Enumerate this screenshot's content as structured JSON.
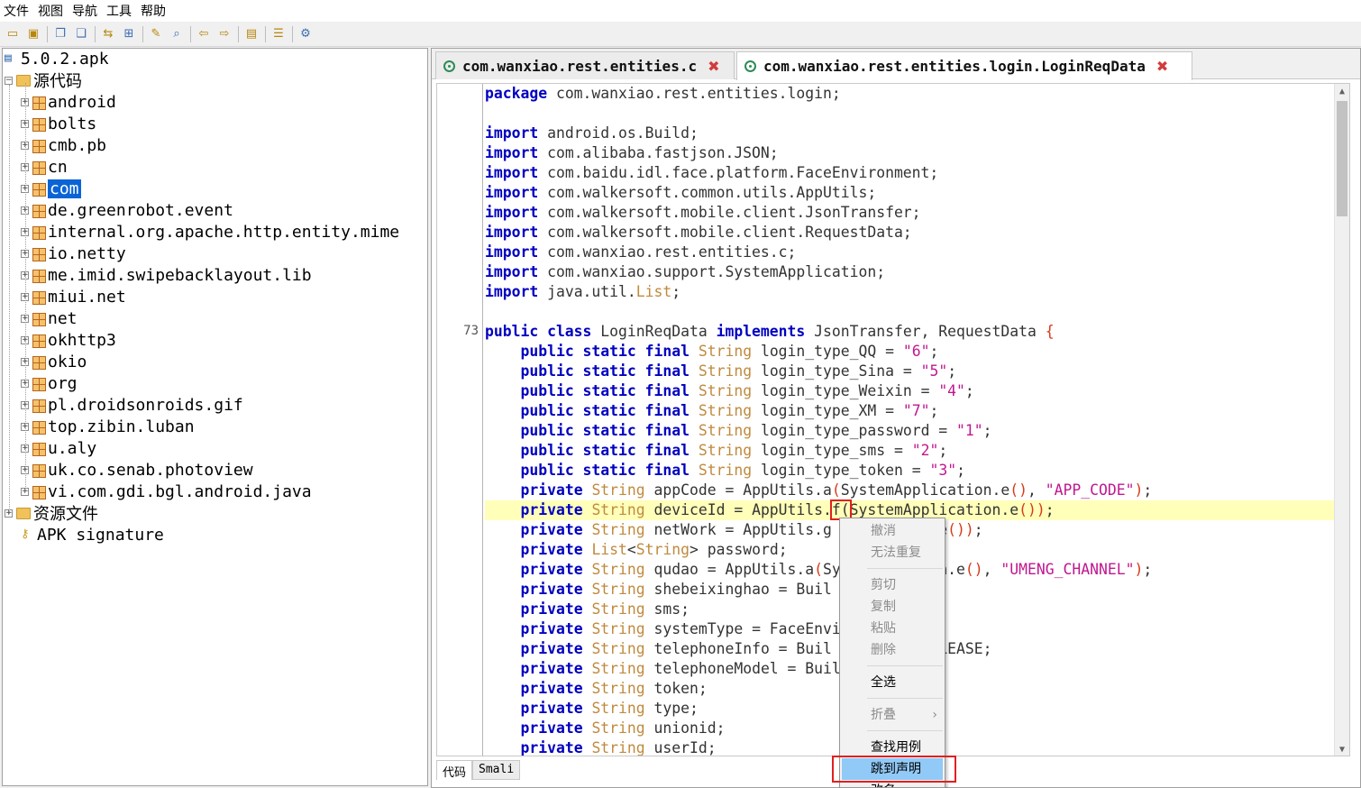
{
  "menu": [
    "文件",
    "视图",
    "导航",
    "工具",
    "帮助"
  ],
  "toolbar_icons": [
    "open-folder-icon",
    "add-folder-icon",
    "copy-icon",
    "paste-icon",
    "sync-icon",
    "grid-icon",
    "wand-icon",
    "search-icon",
    "back-icon",
    "forward-icon",
    "export-icon",
    "log-icon",
    "settings-icon"
  ],
  "tree": {
    "root": "5.0.2.apk",
    "source_folder": "源代码",
    "packages": [
      {
        "label": "android",
        "selected": false
      },
      {
        "label": "bolts",
        "selected": false
      },
      {
        "label": "cmb.pb",
        "selected": false
      },
      {
        "label": "cn",
        "selected": false
      },
      {
        "label": "com",
        "selected": true
      },
      {
        "label": "de.greenrobot.event",
        "selected": false
      },
      {
        "label": "internal.org.apache.http.entity.mime",
        "selected": false
      },
      {
        "label": "io.netty",
        "selected": false
      },
      {
        "label": "me.imid.swipebacklayout.lib",
        "selected": false
      },
      {
        "label": "miui.net",
        "selected": false
      },
      {
        "label": "net",
        "selected": false
      },
      {
        "label": "okhttp3",
        "selected": false
      },
      {
        "label": "okio",
        "selected": false
      },
      {
        "label": "org",
        "selected": false
      },
      {
        "label": "pl.droidsonroids.gif",
        "selected": false
      },
      {
        "label": "top.zibin.luban",
        "selected": false
      },
      {
        "label": "u.aly",
        "selected": false
      },
      {
        "label": "uk.co.senab.photoview",
        "selected": false
      },
      {
        "label": "vi.com.gdi.bgl.android.java",
        "selected": false
      }
    ],
    "resources_folder": "资源文件",
    "signature": "APK signature"
  },
  "tabs": [
    {
      "label": "com.wanxiao.rest.entities.c",
      "close": "✖",
      "active": false
    },
    {
      "label": "com.wanxiao.rest.entities.login.LoginReqData",
      "close": "✖",
      "active": true
    }
  ],
  "editor": {
    "line_number": "73",
    "lines": [
      [
        [
          "kw",
          "package"
        ],
        [
          "tx",
          " com.wanxiao.rest.entities.login;"
        ]
      ],
      [],
      [
        [
          "kw",
          "import"
        ],
        [
          "tx",
          " android.os.Build;"
        ]
      ],
      [
        [
          "kw",
          "import"
        ],
        [
          "tx",
          " com.alibaba.fastjson.JSON;"
        ]
      ],
      [
        [
          "kw",
          "import"
        ],
        [
          "tx",
          " com.baidu.idl.face.platform.FaceEnvironment;"
        ]
      ],
      [
        [
          "kw",
          "import"
        ],
        [
          "tx",
          " com.walkersoft.common.utils.AppUtils;"
        ]
      ],
      [
        [
          "kw",
          "import"
        ],
        [
          "tx",
          " com.walkersoft.mobile.client.JsonTransfer;"
        ]
      ],
      [
        [
          "kw",
          "import"
        ],
        [
          "tx",
          " com.walkersoft.mobile.client.RequestData;"
        ]
      ],
      [
        [
          "kw",
          "import"
        ],
        [
          "tx",
          " com.wanxiao.rest.entities.c;"
        ]
      ],
      [
        [
          "kw",
          "import"
        ],
        [
          "tx",
          " com.wanxiao.support.SystemApplication;"
        ]
      ],
      [
        [
          "kw",
          "import"
        ],
        [
          "tx",
          " java.util."
        ],
        [
          "ty",
          "List"
        ],
        [
          "tx",
          ";"
        ]
      ],
      [],
      [
        [
          "kw",
          "public class"
        ],
        [
          "tx",
          " LoginReqData "
        ],
        [
          "kw",
          "implements"
        ],
        [
          "tx",
          " JsonTransfer, RequestData "
        ],
        [
          "pa",
          "{"
        ]
      ],
      [
        [
          "tx",
          "    "
        ],
        [
          "kw",
          "public static final"
        ],
        [
          "tx",
          " "
        ],
        [
          "ty",
          "String"
        ],
        [
          "tx",
          " login_type_QQ = "
        ],
        [
          "st",
          "\"6\""
        ],
        [
          "tx",
          ";"
        ]
      ],
      [
        [
          "tx",
          "    "
        ],
        [
          "kw",
          "public static final"
        ],
        [
          "tx",
          " "
        ],
        [
          "ty",
          "String"
        ],
        [
          "tx",
          " login_type_Sina = "
        ],
        [
          "st",
          "\"5\""
        ],
        [
          "tx",
          ";"
        ]
      ],
      [
        [
          "tx",
          "    "
        ],
        [
          "kw",
          "public static final"
        ],
        [
          "tx",
          " "
        ],
        [
          "ty",
          "String"
        ],
        [
          "tx",
          " login_type_Weixin = "
        ],
        [
          "st",
          "\"4\""
        ],
        [
          "tx",
          ";"
        ]
      ],
      [
        [
          "tx",
          "    "
        ],
        [
          "kw",
          "public static final"
        ],
        [
          "tx",
          " "
        ],
        [
          "ty",
          "String"
        ],
        [
          "tx",
          " login_type_XM = "
        ],
        [
          "st",
          "\"7\""
        ],
        [
          "tx",
          ";"
        ]
      ],
      [
        [
          "tx",
          "    "
        ],
        [
          "kw",
          "public static final"
        ],
        [
          "tx",
          " "
        ],
        [
          "ty",
          "String"
        ],
        [
          "tx",
          " login_type_password = "
        ],
        [
          "st",
          "\"1\""
        ],
        [
          "tx",
          ";"
        ]
      ],
      [
        [
          "tx",
          "    "
        ],
        [
          "kw",
          "public static final"
        ],
        [
          "tx",
          " "
        ],
        [
          "ty",
          "String"
        ],
        [
          "tx",
          " login_type_sms = "
        ],
        [
          "st",
          "\"2\""
        ],
        [
          "tx",
          ";"
        ]
      ],
      [
        [
          "tx",
          "    "
        ],
        [
          "kw",
          "public static final"
        ],
        [
          "tx",
          " "
        ],
        [
          "ty",
          "String"
        ],
        [
          "tx",
          " login_type_token = "
        ],
        [
          "st",
          "\"3\""
        ],
        [
          "tx",
          ";"
        ]
      ],
      [
        [
          "tx",
          "    "
        ],
        [
          "kw",
          "private"
        ],
        [
          "tx",
          " "
        ],
        [
          "ty",
          "String"
        ],
        [
          "tx",
          " appCode = AppUtils.a"
        ],
        [
          "pa",
          "("
        ],
        [
          "tx",
          "SystemApplication.e"
        ],
        [
          "pa",
          "()"
        ],
        [
          "tx",
          ", "
        ],
        [
          "st",
          "\"APP_CODE\""
        ],
        [
          "pa",
          ")"
        ],
        [
          "tx",
          ";"
        ]
      ],
      [
        [
          "tx",
          "    "
        ],
        [
          "kw",
          "private"
        ],
        [
          "tx",
          " "
        ],
        [
          "ty",
          "String"
        ],
        [
          "tx",
          " deviceId = AppUtils."
        ],
        [
          "box",
          "f("
        ],
        [
          "tx",
          "SystemApplication.e"
        ],
        [
          "pa",
          "())"
        ],
        [
          "tx",
          ";"
        ]
      ],
      [
        [
          "tx",
          "    "
        ],
        [
          "kw",
          "private"
        ],
        [
          "tx",
          " "
        ],
        [
          "ty",
          "String"
        ],
        [
          "tx",
          " netWork = AppUtils.g     cation.e"
        ],
        [
          "pa",
          "())"
        ],
        [
          "tx",
          ";"
        ]
      ],
      [
        [
          "tx",
          "    "
        ],
        [
          "kw",
          "private"
        ],
        [
          "tx",
          " "
        ],
        [
          "ty",
          "List"
        ],
        [
          "tx",
          "<"
        ],
        [
          "ty",
          "String"
        ],
        [
          "tx",
          "> password;"
        ]
      ],
      [
        [
          "tx",
          "    "
        ],
        [
          "kw",
          "private"
        ],
        [
          "tx",
          " "
        ],
        [
          "ty",
          "String"
        ],
        [
          "tx",
          " qudao = AppUtils.a"
        ],
        [
          "pa",
          "("
        ],
        [
          "tx",
          "Sy        tion.e"
        ],
        [
          "pa",
          "()"
        ],
        [
          "tx",
          ", "
        ],
        [
          "st",
          "\"UMENG_CHANNEL\""
        ],
        [
          "pa",
          ")"
        ],
        [
          "tx",
          ";"
        ]
      ],
      [
        [
          "tx",
          "    "
        ],
        [
          "kw",
          "private"
        ],
        [
          "tx",
          " "
        ],
        [
          "ty",
          "String"
        ],
        [
          "tx",
          " shebeixinghao = Buil"
        ]
      ],
      [
        [
          "tx",
          "    "
        ],
        [
          "kw",
          "private"
        ],
        [
          "tx",
          " "
        ],
        [
          "ty",
          "String"
        ],
        [
          "tx",
          " sms;"
        ]
      ],
      [
        [
          "tx",
          "    "
        ],
        [
          "kw",
          "private"
        ],
        [
          "tx",
          " "
        ],
        [
          "ty",
          "String"
        ],
        [
          "tx",
          " systemType = FaceEnvi"
        ]
      ],
      [
        [
          "tx",
          "    "
        ],
        [
          "kw",
          "private"
        ],
        [
          "tx",
          " "
        ],
        [
          "ty",
          "String"
        ],
        [
          "tx",
          " telephoneInfo = Buil            LEASE;"
        ]
      ],
      [
        [
          "tx",
          "    "
        ],
        [
          "kw",
          "private"
        ],
        [
          "tx",
          " "
        ],
        [
          "ty",
          "String"
        ],
        [
          "tx",
          " telephoneModel = Buil"
        ]
      ],
      [
        [
          "tx",
          "    "
        ],
        [
          "kw",
          "private"
        ],
        [
          "tx",
          " "
        ],
        [
          "ty",
          "String"
        ],
        [
          "tx",
          " token;"
        ]
      ],
      [
        [
          "tx",
          "    "
        ],
        [
          "kw",
          "private"
        ],
        [
          "tx",
          " "
        ],
        [
          "ty",
          "String"
        ],
        [
          "tx",
          " type;"
        ]
      ],
      [
        [
          "tx",
          "    "
        ],
        [
          "kw",
          "private"
        ],
        [
          "tx",
          " "
        ],
        [
          "ty",
          "String"
        ],
        [
          "tx",
          " unionid;"
        ]
      ],
      [
        [
          "tx",
          "    "
        ],
        [
          "kw",
          "private"
        ],
        [
          "tx",
          " "
        ],
        [
          "ty",
          "String"
        ],
        [
          "tx",
          " userId;"
        ]
      ]
    ]
  },
  "bottom_tabs": [
    "代码",
    "Smali"
  ],
  "context_menu": {
    "undo": "撤消",
    "redo": "无法重复",
    "cut": "剪切",
    "copy": "复制",
    "paste": "粘贴",
    "delete": "删除",
    "select_all": "全选",
    "fold": "折叠",
    "fold_arrow": "›",
    "find_usage": "查找用例",
    "goto_declaration": "跳到声明",
    "more": "改名"
  },
  "colors": {
    "keyword": "#0000c0",
    "type": "#c08a3e",
    "string": "#c0188f",
    "highlight_line": "#ffffb9",
    "selection": "#0a64d6",
    "menu_hover": "#91c9f7",
    "annotation_red": "#e02020"
  }
}
